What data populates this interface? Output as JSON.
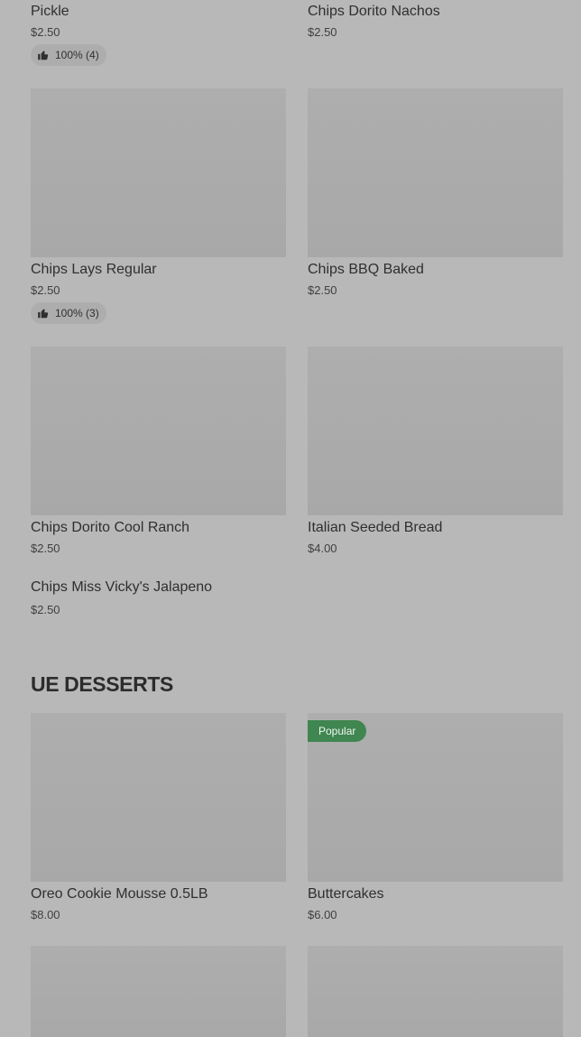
{
  "items": [
    {
      "name": "Pickle",
      "price": "$2.50",
      "rating": "100% (4)"
    },
    {
      "name": "Chips Dorito Nachos",
      "price": "$2.50"
    },
    {
      "name": "Chips Lays Regular",
      "price": "$2.50",
      "rating": "100% (3)"
    },
    {
      "name": "Chips BBQ Baked",
      "price": "$2.50"
    },
    {
      "name": "Chips Dorito Cool Ranch",
      "price": "$2.50"
    },
    {
      "name": "Italian Seeded Bread",
      "price": "$4.00"
    },
    {
      "name": "Chips Miss Vicky's Jalapeno",
      "price": "$2.50"
    }
  ],
  "desserts": {
    "title": "UE DESSERTS",
    "items": [
      {
        "name": "Oreo Cookie Mousse 0.5LB",
        "price": "$8.00"
      },
      {
        "name": "Buttercakes",
        "price": "$6.00",
        "badge": "Popular"
      }
    ]
  },
  "icons": {
    "rating": "thumbs-up-icon"
  },
  "colors": {
    "background": "#b8b8b8",
    "placeholder": "#ababab",
    "text": "#2f2f2f",
    "badge": "#3f8650",
    "rating_pill": "#adadad"
  }
}
